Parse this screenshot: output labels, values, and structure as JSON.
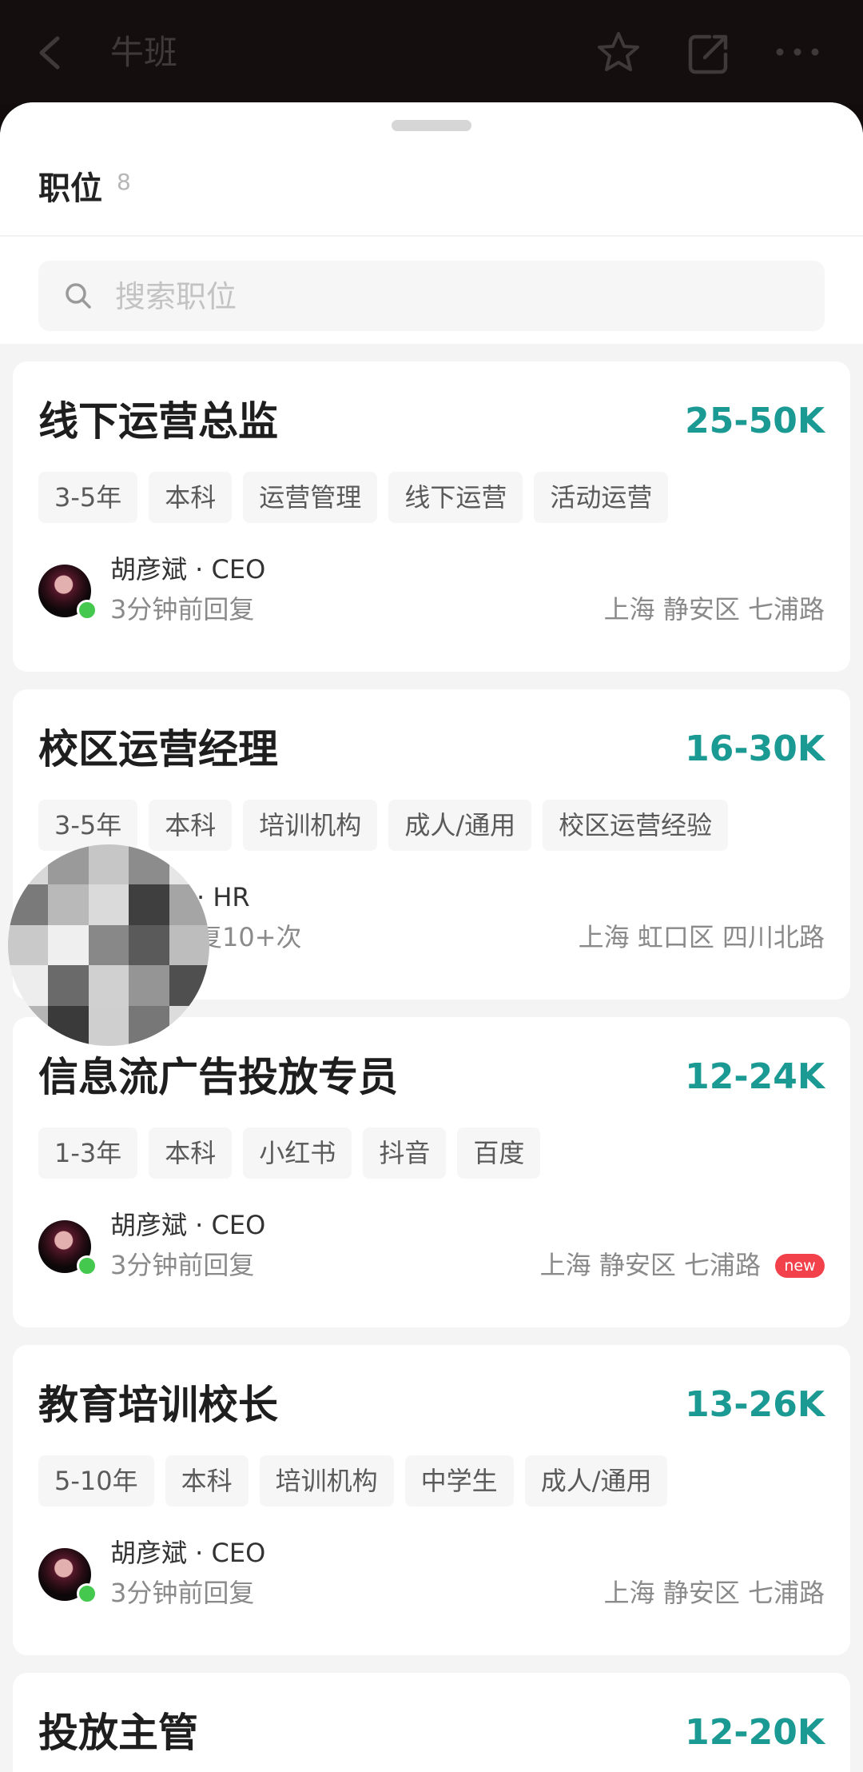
{
  "topbar": {
    "title": "牛班",
    "icons": [
      "back-icon",
      "star-icon",
      "share-icon",
      "more-icon"
    ]
  },
  "section": {
    "title": "职位",
    "count": "8"
  },
  "search": {
    "placeholder": "搜索职位"
  },
  "jobs": [
    {
      "title": "线下运营总监",
      "salary": "25-50K",
      "tags": [
        "3-5年",
        "本科",
        "运营管理",
        "线下运营",
        "活动运营"
      ],
      "recruiter": "胡彦斌 · CEO",
      "reply": "3分钟前回复",
      "location": "上海 静安区 七浦路",
      "is_new": false
    },
    {
      "title": "校区运营经理",
      "salary": "16-30K",
      "tags": [
        "3-5年",
        "本科",
        "培训机构",
        "成人/通用",
        "校区运营经验"
      ],
      "recruiter": "· HR",
      "reply": "复10+次",
      "location": "上海 虹口区 四川北路",
      "is_new": false
    },
    {
      "title": "信息流广告投放专员",
      "salary": "12-24K",
      "tags": [
        "1-3年",
        "本科",
        "小红书",
        "抖音",
        "百度"
      ],
      "recruiter": "胡彦斌 · CEO",
      "reply": "3分钟前回复",
      "location": "上海 静安区 七浦路",
      "is_new": true,
      "new_label": "new"
    },
    {
      "title": "教育培训校长",
      "salary": "13-26K",
      "tags": [
        "5-10年",
        "本科",
        "培训机构",
        "中学生",
        "成人/通用"
      ],
      "recruiter": "胡彦斌 · CEO",
      "reply": "3分钟前回复",
      "location": "上海 静安区 七浦路",
      "is_new": false
    },
    {
      "title": "投放主管",
      "salary": "12-20K"
    }
  ],
  "colors": {
    "salary": "#1a9a93",
    "online": "#44c94e",
    "new_badge": "#f2414b"
  }
}
